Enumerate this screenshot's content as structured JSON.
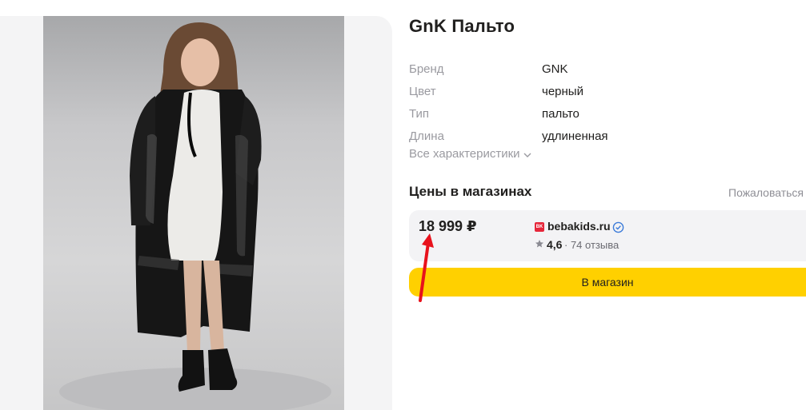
{
  "product": {
    "title": "GnK Пальто"
  },
  "specs": [
    {
      "name": "Бренд",
      "value": "GNK"
    },
    {
      "name": "Цвет",
      "value": "черный"
    },
    {
      "name": "Тип",
      "value": "пальто"
    },
    {
      "name": "Длина",
      "value": "удлиненная"
    }
  ],
  "all_specs_label": "Все характеристики",
  "prices": {
    "title": "Цены в магазинах",
    "complain_label": "Пожаловаться"
  },
  "offer": {
    "price": "18 999 ₽",
    "shop_logo_text": "BK",
    "shop_name": "bebakids.ru",
    "rating": "4,6",
    "reviews": "· 74 отзыва"
  },
  "shop_button_label": "В магазин",
  "colors": {
    "accent_yellow": "#ffd000",
    "shop_logo_red": "#e6263a",
    "verified_blue": "#3b7bd9",
    "annotation_red": "#e8121c"
  }
}
